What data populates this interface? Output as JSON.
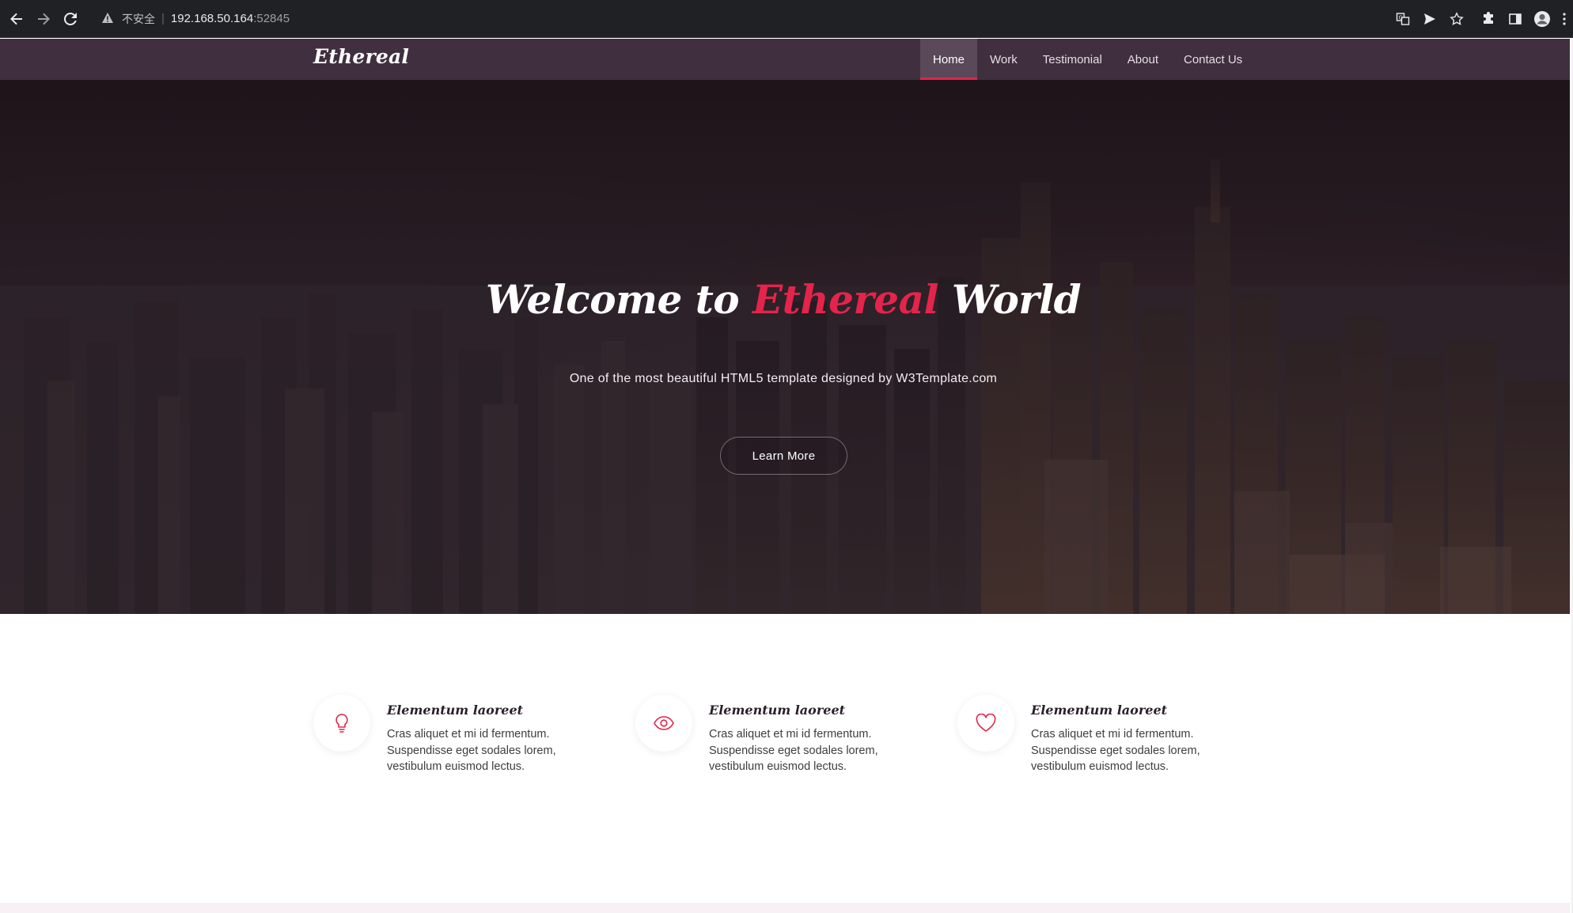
{
  "browser": {
    "security_label": "不安全",
    "url_host": "192.168.50.164",
    "url_port": ":52845"
  },
  "site": {
    "logo": "Ethereal",
    "menu": [
      {
        "label": "Home",
        "active": true
      },
      {
        "label": "Work",
        "active": false
      },
      {
        "label": "Testimonial",
        "active": false
      },
      {
        "label": "About",
        "active": false
      },
      {
        "label": "Contact Us",
        "active": false
      }
    ]
  },
  "hero": {
    "title_prefix": "Welcome to ",
    "title_accent": "Ethereal",
    "title_suffix": " World",
    "subtitle": "One of the most beautiful HTML5 template designed by W3Template.com",
    "button": "Learn More"
  },
  "features": [
    {
      "icon": "lightbulb-icon",
      "title": "Elementum laoreet",
      "line1": "Cras aliquet et mi id fermentum.",
      "line2": "Suspendisse eget sodales lorem,",
      "line3": "vestibulum euismod lectus."
    },
    {
      "icon": "eye-icon",
      "title": "Elementum laoreet",
      "line1": "Cras aliquet et mi id fermentum.",
      "line2": "Suspendisse eget sodales lorem,",
      "line3": "vestibulum euismod lectus."
    },
    {
      "icon": "heart-icon",
      "title": "Elementum laoreet",
      "line1": "Cras aliquet et mi id fermentum.",
      "line2": "Suspendisse eget sodales lorem,",
      "line3": "vestibulum euismod lectus."
    }
  ],
  "colors": {
    "nav_bg": "#40303f",
    "accent": "#e4244b",
    "section_alt_bg": "#f7f1f6"
  }
}
